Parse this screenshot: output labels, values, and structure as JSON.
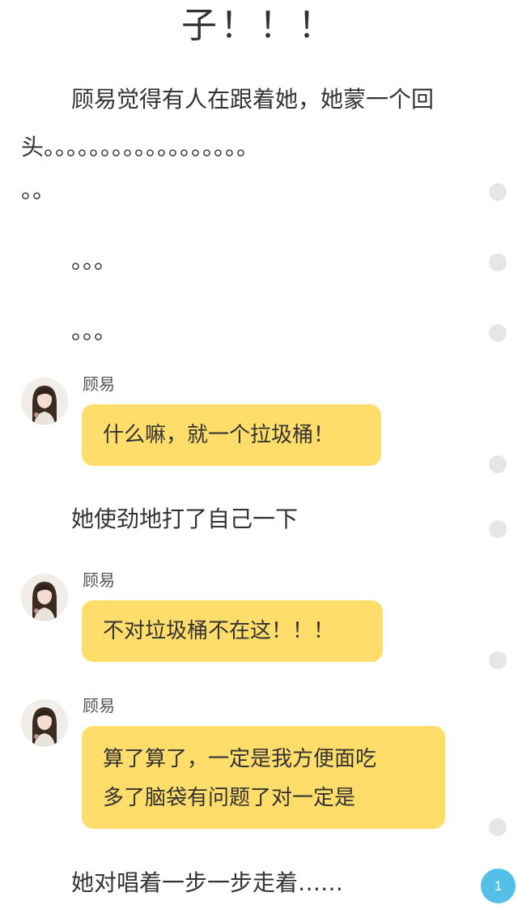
{
  "story": {
    "heading_fragment": "子！！！",
    "paragraph_1_line_1": "顾易觉得有人在跟着她，她蒙一个回",
    "paragraph_1_line_2": "头。。。。。。。。。。。。。。。。。。",
    "paragraph_1_line_3": "。。",
    "ellipsis_1": "。。。",
    "ellipsis_2": "。。。",
    "narration_hit_self": "她使劲地打了自己一下",
    "narration_walking": "她对唱着一步一步走着……"
  },
  "messages": [
    {
      "speaker": "顾易",
      "lines": [
        "什么嘛，就一个拉圾桶！"
      ]
    },
    {
      "speaker": "顾易",
      "lines": [
        "不对垃圾桶不在这！！！"
      ]
    },
    {
      "speaker": "顾易",
      "lines": [
        "算了算了，一定是我方便面吃",
        "多了脑袋有问题了对一定是"
      ]
    }
  ],
  "page_badge": "1",
  "colors": {
    "bubble": "#fedd6b",
    "badge": "#54c0e8",
    "side_dot": "#e6e6e6",
    "text": "#333333"
  }
}
